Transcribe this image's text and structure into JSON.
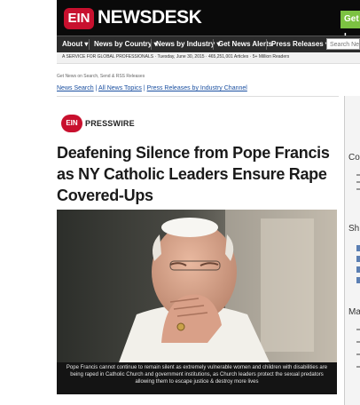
{
  "header": {
    "logo_badge": "EIN",
    "logo_text": "NEWSDESK",
    "cta": "Get I"
  },
  "nav": {
    "items": [
      "About ▾",
      "News by Country ▾",
      "News by Industry ▾",
      "Get News Alerts",
      "Press Releases ▾"
    ],
    "search_placeholder": "Search Ne"
  },
  "subbar": {
    "text": "A SERVICE FOR GLOBAL PROFESSIONALS · Tuesday, June 30, 2015 · 465,251,001 Articles · 5+ Million Readers"
  },
  "breadcrumb": "Get News on Search, Send & RSS Releases",
  "links": {
    "a": "News Search",
    "b": "All News Topics",
    "c": "Press Releases by Industry Channel"
  },
  "press": {
    "badge": "EIN",
    "label": "PRESSWIRE"
  },
  "article": {
    "headline": "Deafening Silence from Pope Francis as NY Catholic Leaders Ensure Rape Covered-Ups",
    "caption": "Pope Francis cannot continue to remain silent as extremely vulnerable women and children with disabilities are being raped in Catholic Church and government institutions, as Church leaders protect the sexual predators allowing them to escape justice & destroy more lives"
  },
  "right": {
    "h1": "Co",
    "h2": "Sh",
    "h3": "Ma"
  }
}
